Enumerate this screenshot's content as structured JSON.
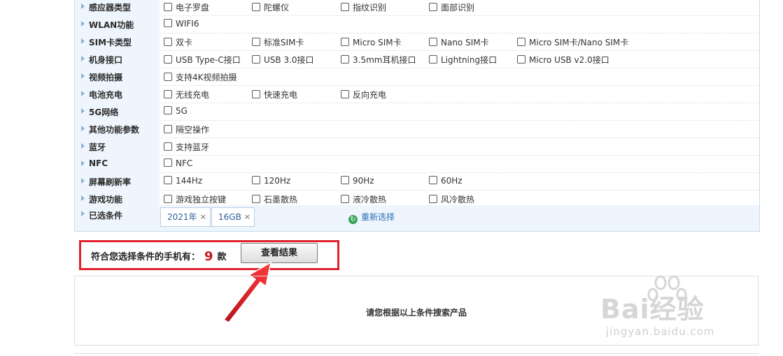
{
  "filters": [
    {
      "label": "感应器类型",
      "options": [
        "电子罗盘",
        "陀螺仪",
        "指纹识别",
        "面部识别"
      ]
    },
    {
      "label": "WLAN功能",
      "options": [
        "WIFI6"
      ]
    },
    {
      "label": "SIM卡类型",
      "options": [
        "双卡",
        "标准SIM卡",
        "Micro SIM卡",
        "Nano SIM卡",
        "Micro SIM卡/Nano SIM卡"
      ]
    },
    {
      "label": "机身接口",
      "options": [
        "USB Type-C接口",
        "USB 3.0接口",
        "3.5mm耳机接口",
        "Lightning接口",
        "Micro USB v2.0接口"
      ]
    },
    {
      "label": "视频拍摄",
      "options": [
        "支持4K视频拍摄"
      ]
    },
    {
      "label": "电池充电",
      "options": [
        "无线充电",
        "快速充电",
        "反向充电"
      ]
    },
    {
      "label": "5G网络",
      "options": [
        "5G"
      ]
    },
    {
      "label": "其他功能参数",
      "options": [
        "隔空操作"
      ]
    },
    {
      "label": "蓝牙",
      "options": [
        "支持蓝牙"
      ]
    },
    {
      "label": "NFC",
      "options": [
        "NFC"
      ]
    },
    {
      "label": "屏幕刷新率",
      "options": [
        "144Hz",
        "120Hz",
        "90Hz",
        "60Hz"
      ]
    },
    {
      "label": "游戏功能",
      "options": [
        "游戏独立按键",
        "石墨散热",
        "液冷散热",
        "风冷散热"
      ]
    }
  ],
  "selected": {
    "label": "已选条件",
    "tags": [
      "2021年",
      "16GB"
    ],
    "close_symbol": "×",
    "reset_label": "重新选择"
  },
  "result": {
    "prefix": "符合您选择条件的手机有：",
    "count": "9",
    "unit": "款",
    "button_label": "查看结果"
  },
  "empty_message": "请您根据以上条件搜索产品",
  "watermark": {
    "brand": "Bai经验",
    "url": "jingyan.baidu.com"
  },
  "colors": {
    "highlight_border": "#e1212b",
    "count": "#c8161d",
    "label_bg": "#eef5fc",
    "link": "#2f6fb6"
  }
}
